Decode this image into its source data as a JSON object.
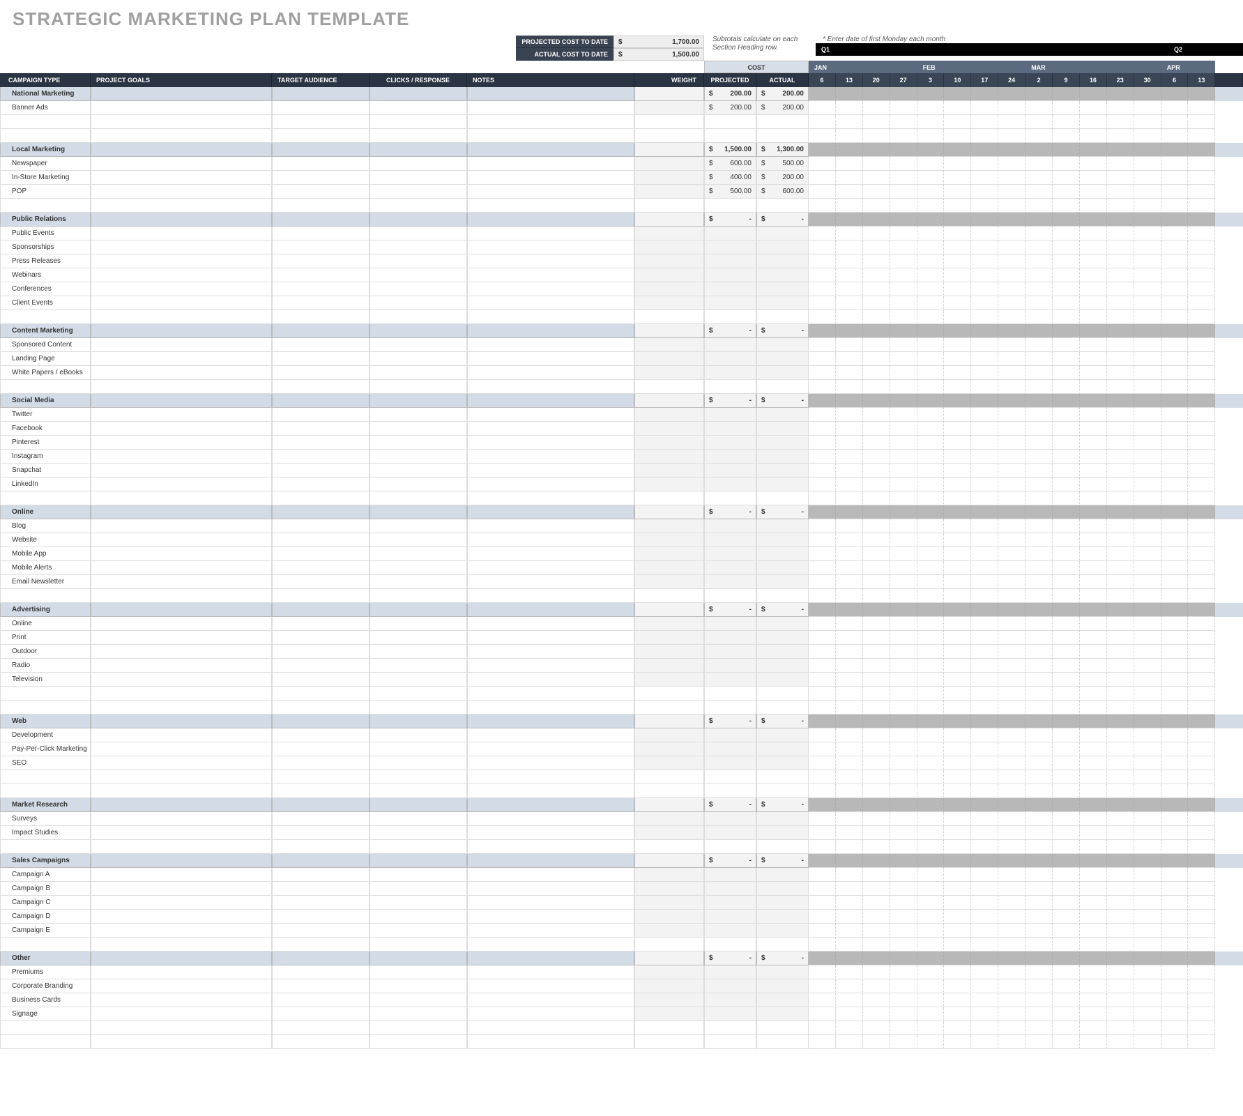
{
  "title": "STRATEGIC MARKETING PLAN TEMPLATE",
  "projected_label": "PROJECTED COST TO DATE",
  "actual_label": "ACTUAL COST TO DATE",
  "currency": "$",
  "projected_total": "1,700.00",
  "actual_total": "1,500.00",
  "subtotal_note_1": "Subtotals calculate on each",
  "subtotal_note_2": "Section Heading row.",
  "date_note": "* Enter date of first Monday each month",
  "quarters": [
    "Q1",
    "Q2"
  ],
  "cost_header": "COST",
  "headers": {
    "type": "CAMPAIGN TYPE",
    "goals": "PROJECT GOALS",
    "aud": "TARGET AUDIENCE",
    "clicks": "CLICKS / RESPONSE",
    "notes": "NOTES",
    "weight": "WEIGHT",
    "proj": "PROJECTED",
    "act": "ACTUAL"
  },
  "months": [
    {
      "name": "JAN",
      "days": [
        "6",
        "13",
        "20",
        "27"
      ]
    },
    {
      "name": "FEB",
      "days": [
        "3",
        "10",
        "17",
        "24"
      ]
    },
    {
      "name": "MAR",
      "days": [
        "2",
        "9",
        "16",
        "23",
        "30"
      ]
    },
    {
      "name": "APR",
      "days": [
        "6",
        "13"
      ]
    }
  ],
  "sections": [
    {
      "name": "National Marketing",
      "proj": "200.00",
      "act": "200.00",
      "rows": [
        {
          "name": "Banner Ads",
          "proj": "200.00",
          "act": "200.00"
        },
        {
          "blank": true
        },
        {
          "blank": true
        }
      ]
    },
    {
      "name": "Local Marketing",
      "proj": "1,500.00",
      "act": "1,300.00",
      "rows": [
        {
          "name": "Newspaper",
          "proj": "600.00",
          "act": "500.00"
        },
        {
          "name": "In-Store Marketing",
          "proj": "400.00",
          "act": "200.00"
        },
        {
          "name": "POP",
          "proj": "500.00",
          "act": "600.00"
        },
        {
          "blank": true
        }
      ]
    },
    {
      "name": "Public Relations",
      "proj": "-",
      "act": "-",
      "rows": [
        {
          "name": "Public Events"
        },
        {
          "name": "Sponsorships"
        },
        {
          "name": "Press Releases"
        },
        {
          "name": "Webinars"
        },
        {
          "name": "Conferences"
        },
        {
          "name": "Client Events"
        },
        {
          "blank": true
        }
      ]
    },
    {
      "name": "Content Marketing",
      "proj": "-",
      "act": "-",
      "rows": [
        {
          "name": "Sponsored Content"
        },
        {
          "name": "Landing Page"
        },
        {
          "name": "White Papers / eBooks"
        },
        {
          "blank": true
        }
      ]
    },
    {
      "name": "Social Media",
      "proj": "-",
      "act": "-",
      "rows": [
        {
          "name": "Twitter"
        },
        {
          "name": "Facebook"
        },
        {
          "name": "Pinterest"
        },
        {
          "name": "Instagram"
        },
        {
          "name": "Snapchat"
        },
        {
          "name": "LinkedIn"
        },
        {
          "blank": true
        }
      ]
    },
    {
      "name": "Online",
      "proj": "-",
      "act": "-",
      "rows": [
        {
          "name": "Blog"
        },
        {
          "name": "Website"
        },
        {
          "name": "Mobile App"
        },
        {
          "name": "Mobile Alerts"
        },
        {
          "name": "Email Newsletter"
        },
        {
          "blank": true
        }
      ]
    },
    {
      "name": "Advertising",
      "proj": "-",
      "act": "-",
      "rows": [
        {
          "name": "Online"
        },
        {
          "name": "Print"
        },
        {
          "name": "Outdoor"
        },
        {
          "name": "Radio"
        },
        {
          "name": "Television"
        },
        {
          "blank": true
        },
        {
          "blank": true
        }
      ]
    },
    {
      "name": "Web",
      "proj": "-",
      "act": "-",
      "rows": [
        {
          "name": "Development"
        },
        {
          "name": "Pay-Per-Click Marketing"
        },
        {
          "name": "SEO"
        },
        {
          "blank": true
        },
        {
          "blank": true
        }
      ]
    },
    {
      "name": "Market Research",
      "proj": "-",
      "act": "-",
      "rows": [
        {
          "name": "Surveys"
        },
        {
          "name": "Impact Studies"
        },
        {
          "blank": true
        }
      ]
    },
    {
      "name": "Sales Campaigns",
      "proj": "-",
      "act": "-",
      "rows": [
        {
          "name": "Campaign A"
        },
        {
          "name": "Campaign B"
        },
        {
          "name": "Campaign C"
        },
        {
          "name": "Campaign D"
        },
        {
          "name": "Campaign E"
        },
        {
          "blank": true
        }
      ]
    },
    {
      "name": "Other",
      "proj": "-",
      "act": "-",
      "rows": [
        {
          "name": "Premiums"
        },
        {
          "name": "Corporate Branding"
        },
        {
          "name": "Business Cards"
        },
        {
          "name": "Signage"
        },
        {
          "blank": true
        },
        {
          "blank": true
        }
      ]
    }
  ]
}
